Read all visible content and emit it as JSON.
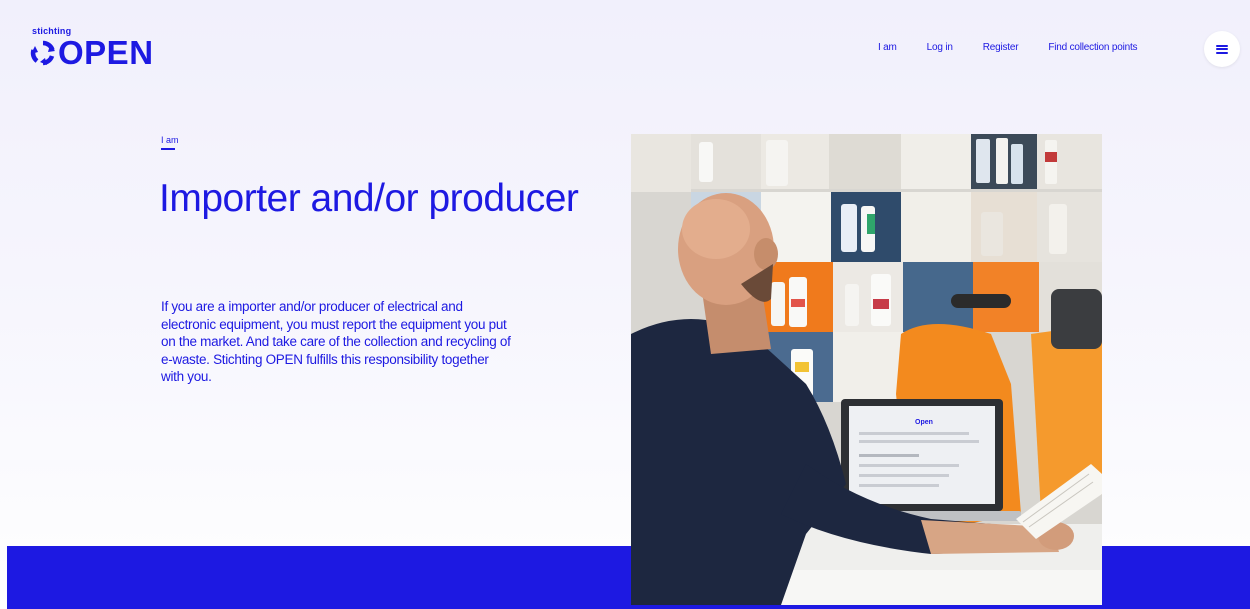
{
  "brand": {
    "small": "stichting",
    "name": "OPEN"
  },
  "nav": {
    "items": [
      "I am",
      "Log in",
      "Register",
      "Find collection points"
    ]
  },
  "menu": {
    "icon": "hamburger-icon"
  },
  "breadcrumb": {
    "label": "I am"
  },
  "hero": {
    "title": "Importer and/or producer",
    "intro": "If you are a importer and/or producer of electrical and electronic equipment, you must report the equipment you put on the market. And take care of the collection and recycling of e-waste. Stichting OPEN fulfills this responsibility together with you.",
    "image_alt": "Man at a laptop reading a document in front of a shelving unit with cleaning products and an orange cleaning machine",
    "laptop_screen_text": "Open"
  },
  "colors": {
    "brand_blue": "#1d19e2",
    "background": "#f4f3fd",
    "band": "#1d19e2"
  }
}
